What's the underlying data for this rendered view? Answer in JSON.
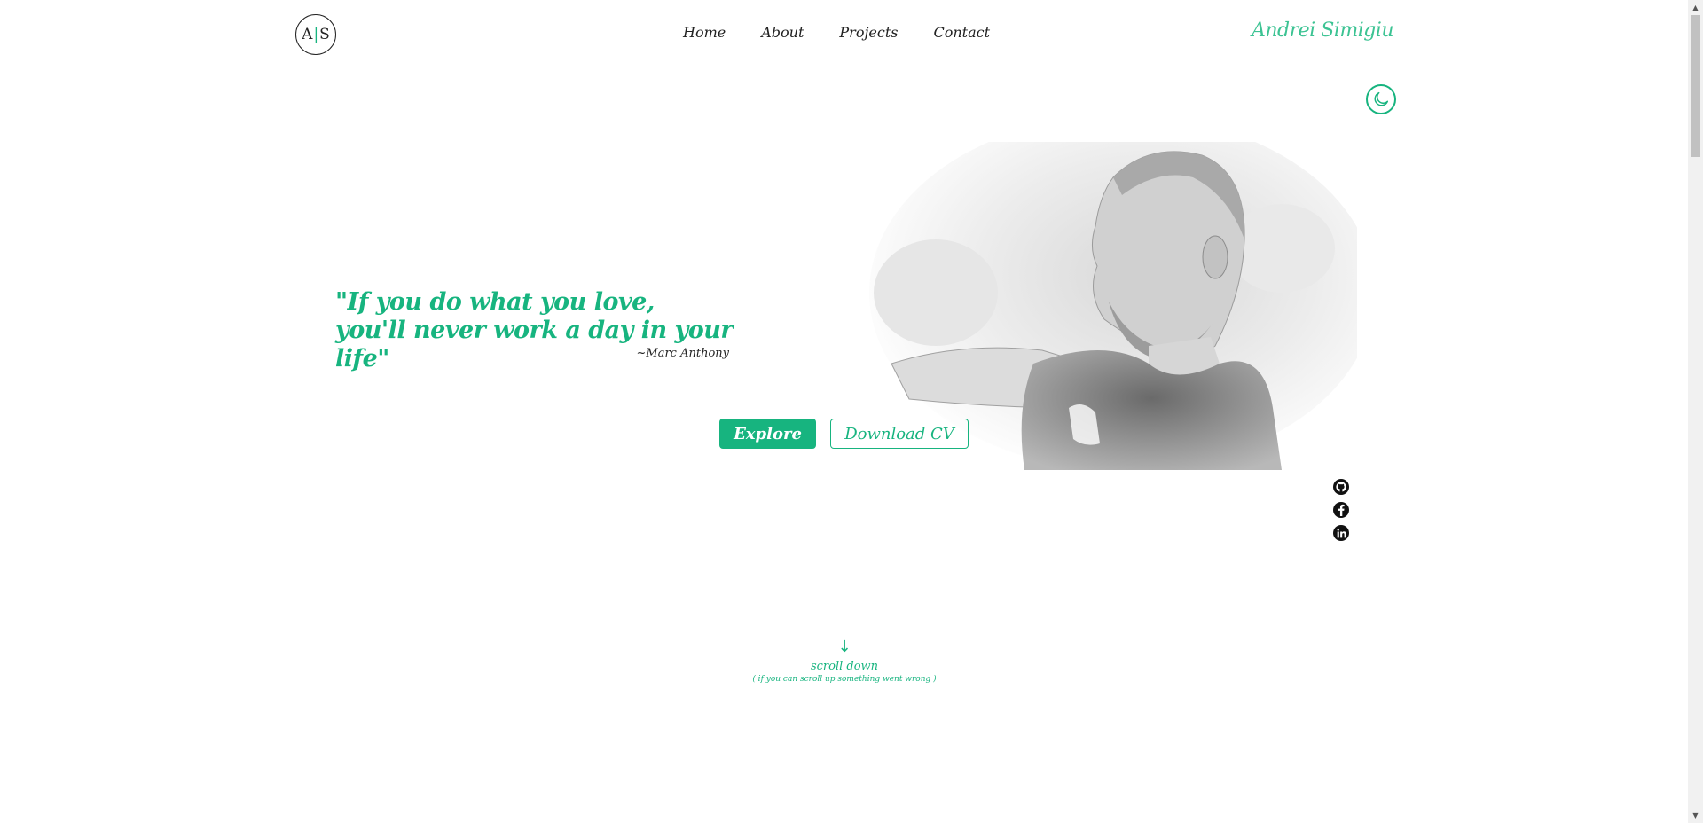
{
  "header": {
    "logo": {
      "left": "A",
      "separator": "|",
      "right": "S"
    },
    "nav": [
      "Home",
      "About",
      "Projects",
      "Contact"
    ],
    "brand": "Andrei Simigiu"
  },
  "theme_toggle": {
    "icon": "moon-icon"
  },
  "hero": {
    "quote_line1": "\"If you do what you love,",
    "quote_line2": "you'll never work a day in your life\"",
    "author": "~Marc Anthony",
    "explore_label": "Explore",
    "download_cv_label": "Download CV"
  },
  "socials": [
    {
      "icon": "github-icon"
    },
    {
      "icon": "facebook-icon"
    },
    {
      "icon": "linkedin-icon"
    }
  ],
  "scroll": {
    "arrow": "↓",
    "label": "scroll down",
    "note": "( if you can scroll up something went wrong )"
  },
  "colors": {
    "accent": "#17b47f",
    "text": "#222222",
    "brand": "#3cc393"
  }
}
